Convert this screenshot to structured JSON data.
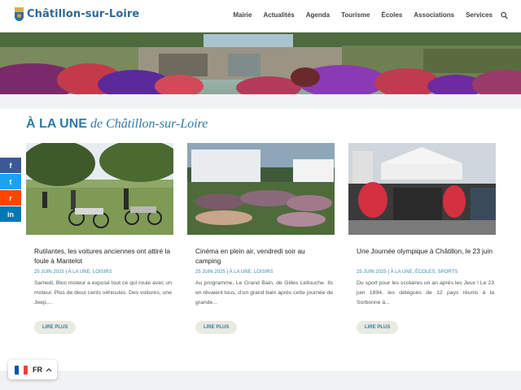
{
  "header": {
    "logo_text": "Châtillon-sur-Loire",
    "nav": [
      "Mairie",
      "Actualités",
      "Agenda",
      "Tourisme",
      "Écoles",
      "Associations",
      "Services"
    ]
  },
  "section": {
    "title_bold": "À LA UNE",
    "title_italic": " de Châtillon-sur-Loire"
  },
  "cards": [
    {
      "title": "Rutilantes, les voitures anciennes ont attiré la foule à Mantelot",
      "date": "25 JUIN 2025",
      "categories": "À LA UNE, LOISIRS",
      "excerpt": "Samedi, Bloc moteur a exposé tout ce qui roule avec un moteur. Plus de deux cents véhicules. Des voitures, une Jeep,...",
      "button": "LIRE PLUS"
    },
    {
      "title": "Cinéma en plein air, vendredi soir au camping",
      "date": "25 JUIN 2025",
      "categories": "À LA UNE, LOISIRS",
      "excerpt": "Au programme, Le Grand Bain, de Gilles Lellouche. Ils en rêvaient tous, d’un grand bain après cette journée de grande...",
      "button": "LIRE PLUS"
    },
    {
      "title": "Une Journée olympique à Châtillon, le 23 juin",
      "date": "25 JUIN 2025",
      "categories": "À LA UNE, ÉCOLES, SPORTS",
      "excerpt": "Du sport pour les scolaires un an après les Jeux ! Le 23 juin 1894, les délégués de 12 pays réunis à la Sorbonne à...",
      "button": "LIRE PLUS"
    }
  ],
  "social": [
    {
      "icon": "facebook-icon",
      "glyph": "f",
      "color": "#3b5998"
    },
    {
      "icon": "twitter-icon",
      "glyph": "t",
      "color": "#1da1f2"
    },
    {
      "icon": "reddit-icon",
      "glyph": "r",
      "color": "#ff4500"
    },
    {
      "icon": "linkedin-icon",
      "glyph": "in",
      "color": "#0077b5"
    }
  ],
  "language": {
    "code": "FR"
  },
  "colors": {
    "accent": "#2c7ba5",
    "button_bg": "#ebeae1"
  }
}
